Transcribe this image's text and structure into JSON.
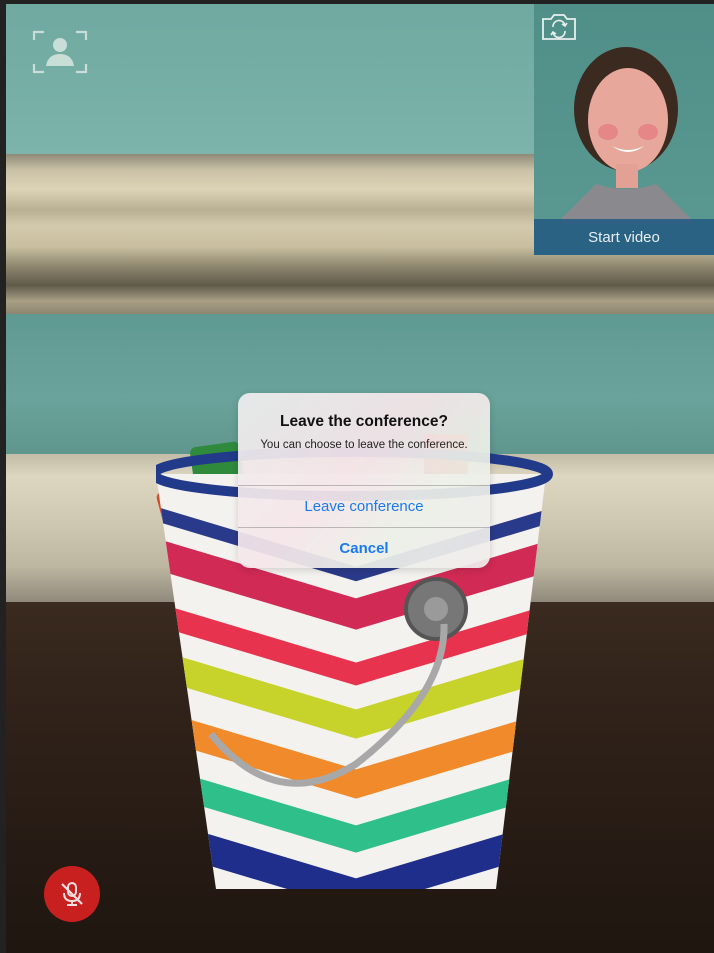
{
  "self_view": {
    "label": "Start video",
    "camera_switch_icon": "camera-rotate-icon"
  },
  "top_left_icon": "speaker-view-icon",
  "mute_button": {
    "icon": "microphone-muted-icon",
    "color": "#c8201f"
  },
  "alert": {
    "title": "Leave the conference?",
    "message": "You can choose to leave the conference.",
    "buttons": [
      {
        "label": "Leave conference",
        "style": "default"
      },
      {
        "label": "Cancel",
        "style": "bold"
      }
    ],
    "accent": "#1a7af0"
  }
}
